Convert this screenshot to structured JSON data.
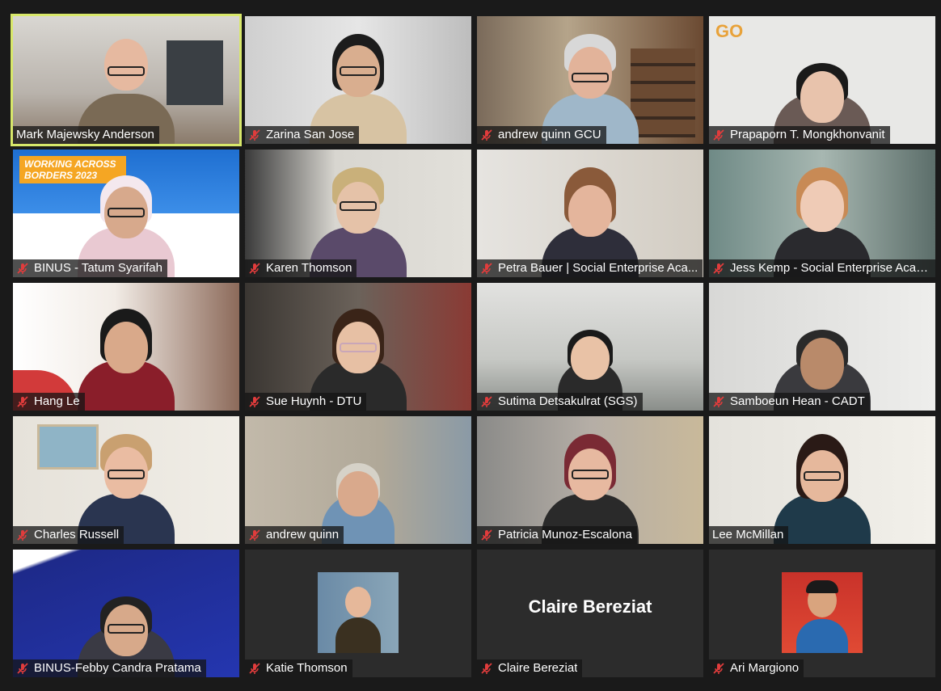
{
  "participants": [
    {
      "name": "Mark Majewsky Anderson",
      "muted": false,
      "active": true
    },
    {
      "name": "Zarina San Jose",
      "muted": true
    },
    {
      "name": "andrew quinn GCU",
      "muted": true
    },
    {
      "name": "Prapaporn T.  Mongkhonvanit",
      "muted": true
    },
    {
      "name": "BINUS - Tatum Syarifah",
      "muted": true
    },
    {
      "name": "Karen Thomson",
      "muted": true
    },
    {
      "name": "Petra Bauer | Social Enterprise Aca...",
      "muted": true
    },
    {
      "name": "Jess Kemp - Social Enterprise Acad...",
      "muted": true
    },
    {
      "name": "Hang Le",
      "muted": true
    },
    {
      "name": "Sue Huynh - DTU",
      "muted": true
    },
    {
      "name": "Sutima Detsakulrat (SGS)",
      "muted": true
    },
    {
      "name": "Samboeun Hean - CADT",
      "muted": true
    },
    {
      "name": "Charles Russell",
      "muted": true
    },
    {
      "name": "andrew quinn",
      "muted": true
    },
    {
      "name": "Patricia Munoz-Escalona",
      "muted": true
    },
    {
      "name": "Lee McMillan",
      "muted": false
    },
    {
      "name": "BINUS-Febby Candra Pratama",
      "muted": true
    },
    {
      "name": "Katie Thomson",
      "muted": true
    },
    {
      "name": "Claire Bereziat",
      "muted": true
    },
    {
      "name": "Ari Margiono",
      "muted": true
    }
  ],
  "tiles": {
    "binus_banner": "WORKING ACROSS BORDERS 2023",
    "claire_center": "Claire Bereziat"
  },
  "colors": {
    "active_border": "#d8e86a",
    "muted_icon": "#e03c3c",
    "background": "#1a1a1a"
  }
}
